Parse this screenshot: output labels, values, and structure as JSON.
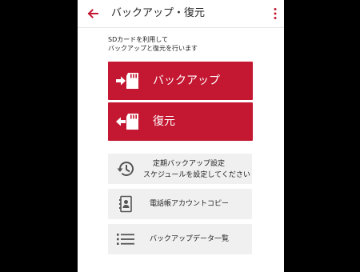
{
  "header": {
    "title": "バックアップ・復元"
  },
  "description": {
    "line1": "SDカードを利用して",
    "line2": "バックアップと復元を行います"
  },
  "primary_buttons": [
    {
      "label": "バックアップ",
      "icon": "sd-card-arrow-in-icon"
    },
    {
      "label": "復元",
      "icon": "sd-card-arrow-out-icon"
    }
  ],
  "secondary_buttons": [
    {
      "label": "定期バックアップ設定",
      "sublabel": "スケジュールを設定してください",
      "icon": "history-icon"
    },
    {
      "label": "電話帳アカウントコピー",
      "icon": "contact-book-icon"
    },
    {
      "label": "バックアップデータ一覧",
      "icon": "list-icon"
    }
  ],
  "colors": {
    "accent": "#c41731",
    "secondary_bg": "#f0f0f0"
  }
}
